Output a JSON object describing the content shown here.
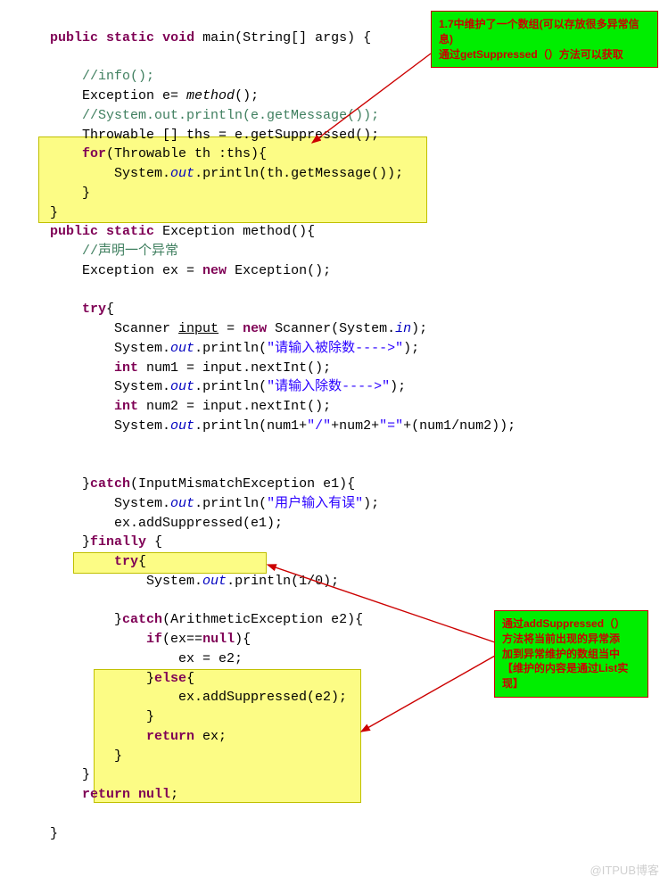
{
  "code": {
    "l1_kw1": "public",
    "l1_kw2": "static",
    "l1_kw3": "void",
    "l1_t1": " main(String[] args) {",
    "l3_com": "//info();",
    "l4_t1": "Exception e= ",
    "l4_m": "method",
    "l4_t2": "();",
    "l5_com": "//System.out.println(e.getMessage());",
    "l6_t1": "Throwable [] ths = e.getSuppressed();",
    "l7_kw": "for",
    "l7_t1": "(Throwable th :ths){",
    "l8_t1": "System.",
    "l8_f": "out",
    "l8_t2": ".println(th.getMessage());",
    "l9_t1": "}",
    "l10_t1": "}",
    "l11_kw1": "public",
    "l11_kw2": "static",
    "l11_t1": " Exception method(){",
    "l12_com": "//声明一个异常",
    "l13_t1": "Exception ex = ",
    "l13_kw": "new",
    "l13_t2": " Exception();",
    "l15_kw": "try",
    "l15_t1": "{",
    "l16_t1": "Scanner ",
    "l16_v": "input",
    "l16_t2": " = ",
    "l16_kw": "new",
    "l16_t3": " Scanner(System.",
    "l16_f": "in",
    "l16_t4": ");",
    "l17_t1": "System.",
    "l17_f": "out",
    "l17_t2": ".println(",
    "l17_s": "\"请输入被除数---->\"",
    "l17_t3": ");",
    "l18_kw": "int",
    "l18_t1": " num1 = input.nextInt();",
    "l19_t1": "System.",
    "l19_f": "out",
    "l19_t2": ".println(",
    "l19_s": "\"请输入除数---->\"",
    "l19_t3": ");",
    "l20_kw": "int",
    "l20_t1": " num2 = input.nextInt();",
    "l21_t1": "System.",
    "l21_f": "out",
    "l21_t2": ".println(num1+",
    "l21_s1": "\"/\"",
    "l21_t3": "+num2+",
    "l21_s2": "\"=\"",
    "l21_t4": "+(num1/num2));",
    "l24_t1": "}",
    "l24_kw": "catch",
    "l24_t2": "(InputMismatchException e1){",
    "l25_t1": "System.",
    "l25_f": "out",
    "l25_t2": ".println(",
    "l25_s": "\"用户输入有误\"",
    "l25_t3": ");",
    "l26_t1": "ex.addSuppressed(e1);",
    "l27_t1": "}",
    "l27_kw": "finally",
    "l27_t2": " {",
    "l28_kw": "try",
    "l28_t1": "{",
    "l29_t1": "System.",
    "l29_f": "out",
    "l29_t2": ".println(1/0);",
    "l31_t1": "}",
    "l31_kw": "catch",
    "l31_t2": "(ArithmeticException e2){",
    "l32_kw": "if",
    "l32_t1": "(ex==",
    "l32_kw2": "null",
    "l32_t2": "){",
    "l33_t1": "ex = e2;",
    "l34_t1": "}",
    "l34_kw": "else",
    "l34_t2": "{",
    "l35_t1": "ex.addSuppressed(e2);",
    "l36_t1": "}",
    "l37_kw": "return",
    "l37_t1": " ex;",
    "l38_t1": "}",
    "l39_t1": "}",
    "l40_kw": "return",
    "l40_t1": " ",
    "l40_kw2": "null",
    "l40_t2": ";",
    "l42_t1": "}"
  },
  "annotation1": {
    "line1": "1.7中维护了一个数组(可以存放很多异常信",
    "line2": "息)",
    "line3": "通过getSuppressed（）方法可以获取"
  },
  "annotation2": {
    "line1": "通过addSuppressed（）",
    "line2": "方法将当前出现的异常添",
    "line3": "加到异常维护的数组当中",
    "line4": "【维护的内容是通过List实",
    "line5": "现】"
  },
  "watermark": "@ITPUB博客"
}
